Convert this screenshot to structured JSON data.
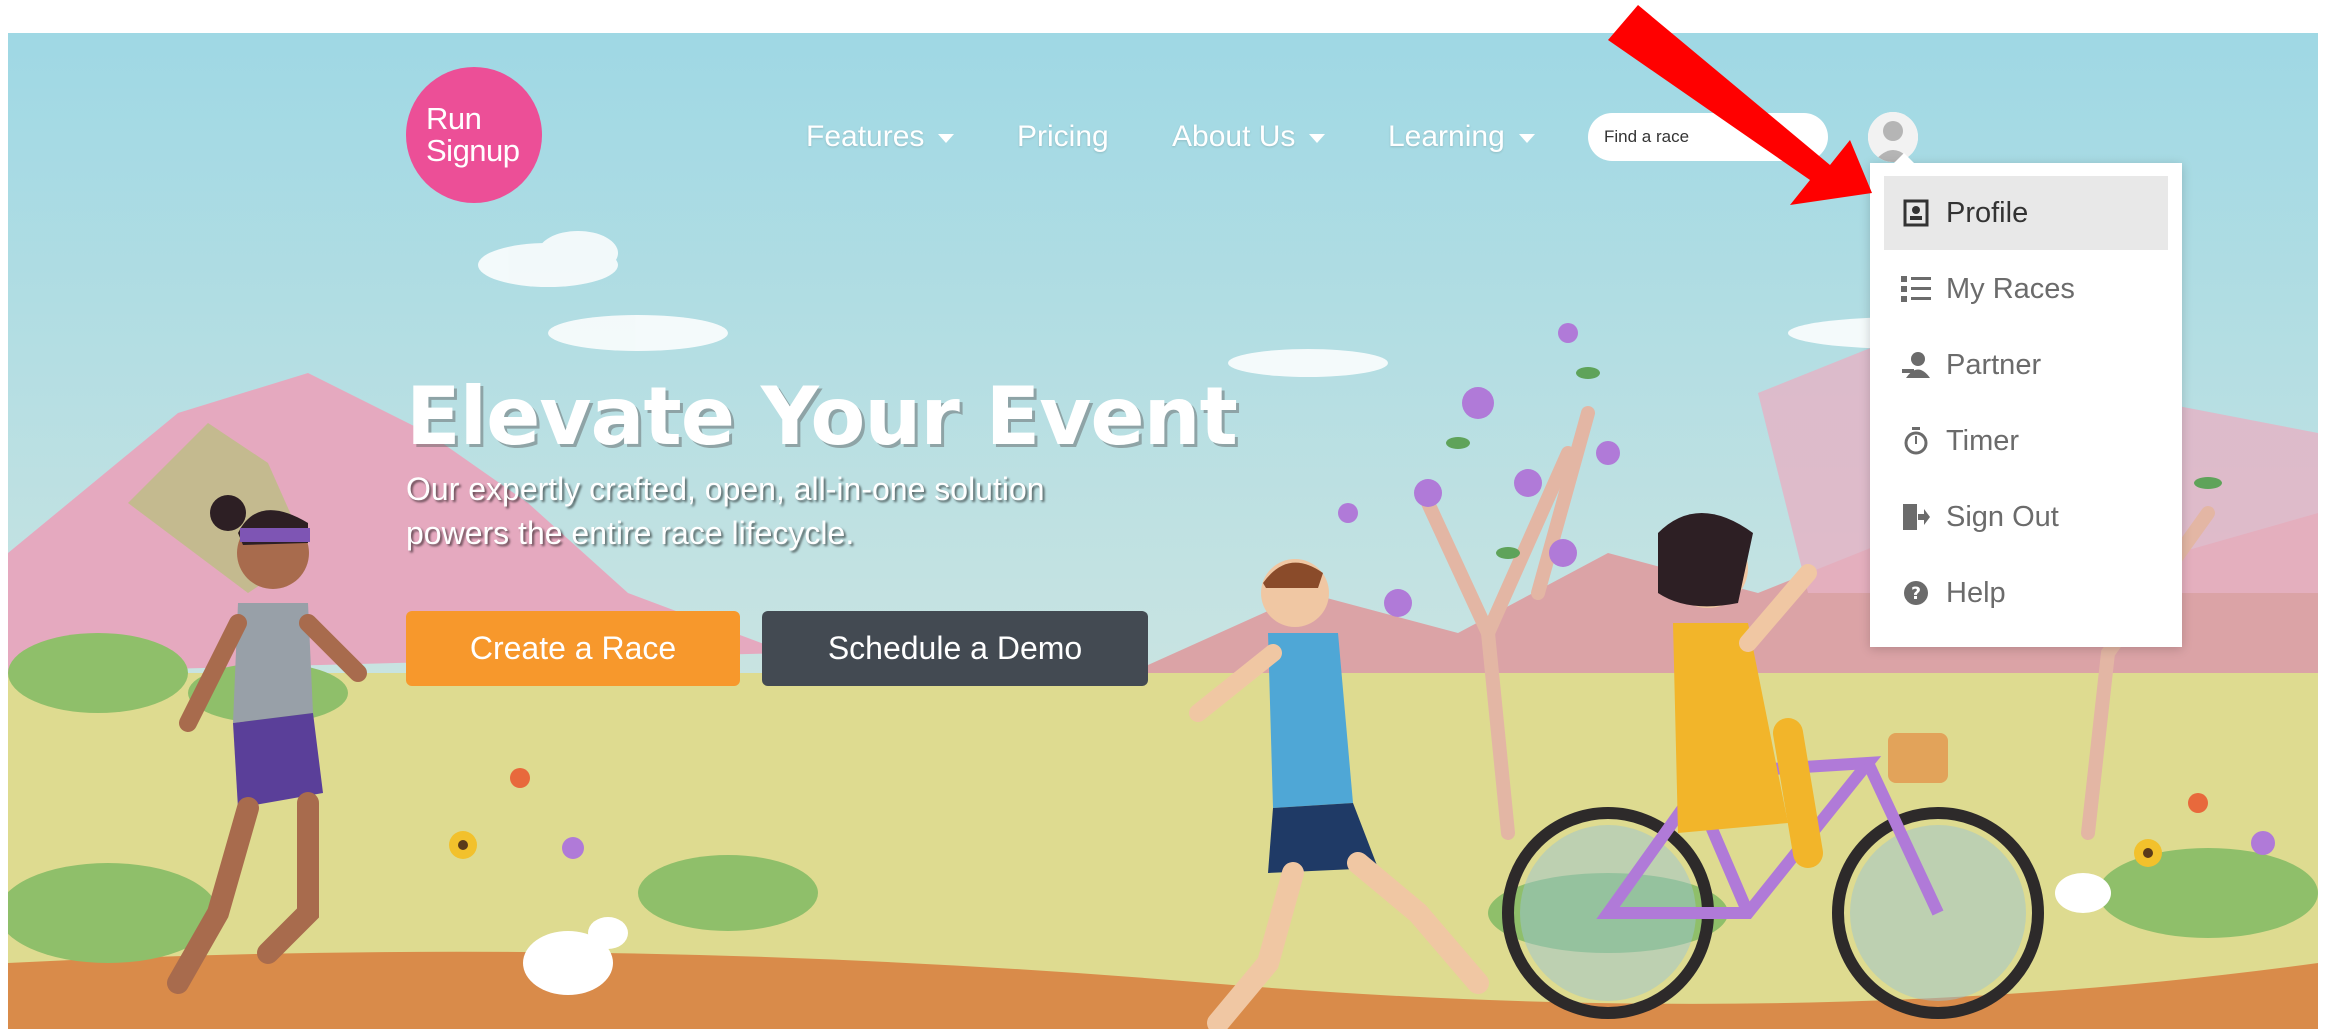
{
  "brand": {
    "logo_line1": "Run",
    "logo_line2": "Signup",
    "logo_color": "#ec4f97"
  },
  "nav": {
    "features": "Features",
    "pricing": "Pricing",
    "about": "About Us",
    "learning": "Learning",
    "search_placeholder": "Find a race"
  },
  "user_menu": {
    "items": [
      {
        "label": "Profile",
        "icon": "profile-card-icon",
        "active": true
      },
      {
        "label": "My Races",
        "icon": "list-icon"
      },
      {
        "label": "Partner",
        "icon": "partner-icon"
      },
      {
        "label": "Timer",
        "icon": "stopwatch-icon"
      },
      {
        "label": "Sign Out",
        "icon": "sign-out-icon"
      },
      {
        "label": "Help",
        "icon": "question-circle-icon"
      }
    ]
  },
  "hero": {
    "title": "Elevate Your Event",
    "subtitle_line1": "Our expertly crafted, open, all-in-one solution",
    "subtitle_line2": "powers the entire race lifecycle.",
    "create_button": "Create a Race",
    "demo_button": "Schedule a Demo"
  },
  "colors": {
    "sky": "#9fd8e4",
    "ground": "#dedb90",
    "create_button": "#f7982c",
    "demo_button": "#434a52",
    "annotation_arrow": "#ff0000"
  }
}
